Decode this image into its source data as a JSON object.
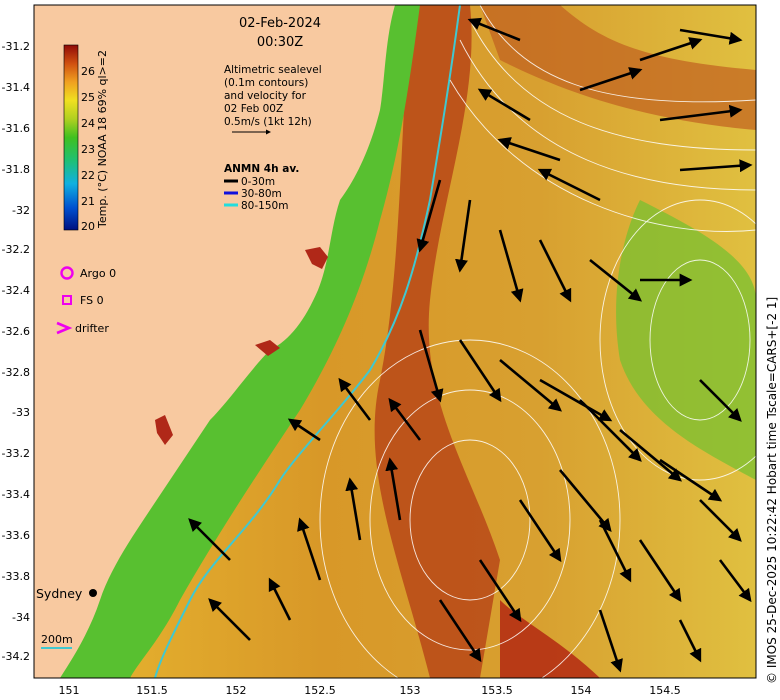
{
  "map": {
    "date": "02-Feb-2024",
    "time": "00:30Z",
    "info_lines": [
      "Altimetric sealevel",
      "(0.1m contours)",
      "and velocity for",
      "02 Feb 00Z",
      "0.5m/s (1kt 12h)"
    ],
    "anmn_title": "ANMN 4h av.",
    "anmn_legend": [
      {
        "label": "0-30m",
        "color": "#000000"
      },
      {
        "label": "30-80m",
        "color": "#1010dd"
      },
      {
        "label": "80-150m",
        "color": "#22dddd"
      }
    ],
    "symbols": [
      {
        "label": "Argo 0",
        "color": "#ee00ee"
      },
      {
        "label": "FS 0",
        "color": "#ee00ee"
      },
      {
        "label": "drifter",
        "color": "#ee00ee"
      }
    ],
    "colorbar": {
      "label": "Temp. (°C) NOAA 18 69% ql>=2",
      "ticks": [
        "26",
        "25",
        "24",
        "23",
        "22",
        "21",
        "20"
      ],
      "range": [
        20,
        27
      ]
    },
    "city": "Sydney",
    "depth_label": "200m",
    "lat_ticks": [
      "-31.2",
      "-31.4",
      "-31.6",
      "-31.8",
      "-32",
      "-32.2",
      "-32.4",
      "-32.6",
      "-32.8",
      "-33",
      "-33.2",
      "-33.4",
      "-33.6",
      "-33.8",
      "-34",
      "-34.2"
    ],
    "lon_ticks": [
      "151",
      "151.5",
      "152",
      "152.5",
      "153",
      "153.5",
      "154",
      "154.5"
    ],
    "credit": "© IMOS 25-Dec-2025 10:22:42 Hobart time Tscale=CARS+[-2 1]",
    "colors": {
      "land": "#f8c9a0",
      "warm": "#b04010",
      "cool": "#38b838",
      "shelf_line": "#40c8d0"
    }
  }
}
